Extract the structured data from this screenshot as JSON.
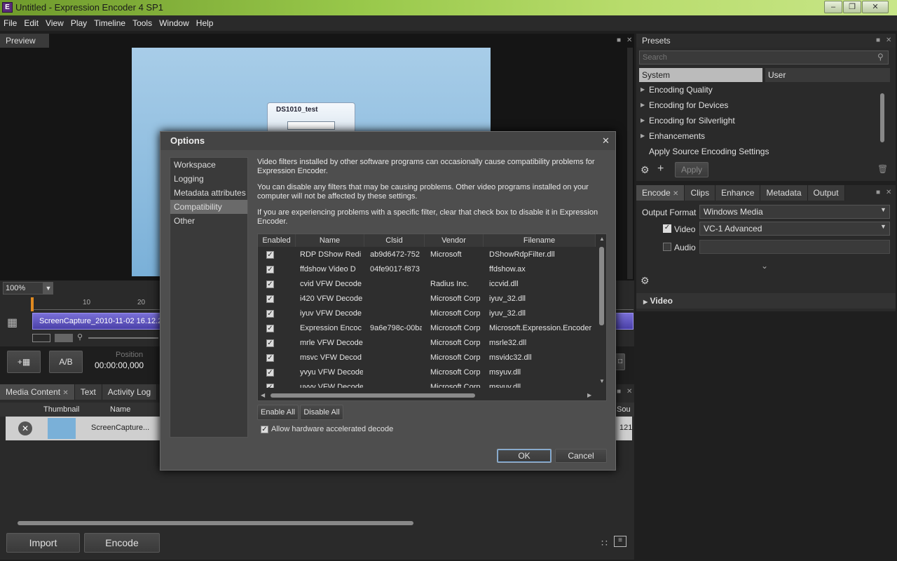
{
  "window": {
    "title": "Untitled - Expression Encoder 4 SP1",
    "icon": "app-icon"
  },
  "menu": [
    "File",
    "Edit",
    "View",
    "Play",
    "Timeline",
    "Tools",
    "Window",
    "Help"
  ],
  "preview": {
    "header": "Preview",
    "zoom": "100%",
    "node_title": "DS1010_test"
  },
  "timeline": {
    "ticks": [
      "10",
      "20"
    ],
    "clip_label": "ScreenCapture_2010-11-02 16.12.2"
  },
  "transport": {
    "ab_label": "A/B",
    "position_label": "Position",
    "position_value": "00:00:00,000"
  },
  "media": {
    "tabs": [
      "Media Content",
      "Text",
      "Activity Log"
    ],
    "col_thumbnail": "Thumbnail",
    "col_name": "Name",
    "col_source": "Sou",
    "item_name": "ScreenCapture...",
    "item_source": "121",
    "import_label": "Import",
    "encode_label": "Encode"
  },
  "presets": {
    "header": "Presets",
    "search_placeholder": "Search",
    "tabs": [
      "System",
      "User"
    ],
    "items": [
      {
        "label": "Encoding Quality",
        "expandable": true
      },
      {
        "label": "Encoding for Devices",
        "expandable": true
      },
      {
        "label": "Encoding for Silverlight",
        "expandable": true
      },
      {
        "label": "Enhancements",
        "expandable": true
      },
      {
        "label": "Apply Source Encoding Settings",
        "expandable": false
      }
    ],
    "apply_label": "Apply"
  },
  "encode": {
    "tabs": [
      "Encode",
      "Clips",
      "Enhance",
      "Metadata",
      "Output"
    ],
    "output_format_label": "Output Format",
    "output_format_value": "Windows Media",
    "video_label": "Video",
    "video_value": "VC-1 Advanced",
    "video_checked": true,
    "audio_label": "Audio",
    "audio_checked": false,
    "video_section": "Video"
  },
  "dialog": {
    "title": "Options",
    "nav": [
      "Workspace",
      "Logging",
      "Metadata attributes",
      "Compatibility",
      "Other"
    ],
    "selected_nav": "Compatibility",
    "para1": "Video filters installed by other software programs can occasionally cause compatibility problems for Expression Encoder.",
    "para2": "You can disable any filters that may be causing problems. Other video programs installed on your computer will not be affected by these settings.",
    "para3": "If you are experiencing problems with a specific filter, clear that check box to disable it in Expression Encoder.",
    "columns": [
      "Enabled",
      "Name",
      "Clsid",
      "Vendor",
      "Filename"
    ],
    "rows": [
      {
        "enabled": true,
        "name": "RDP DShow Redi",
        "clsid": "ab9d6472-752",
        "vendor": "Microsoft",
        "filename": "DShowRdpFilter.dll"
      },
      {
        "enabled": true,
        "name": "ffdshow Video D",
        "clsid": "04fe9017-f873",
        "vendor": "",
        "filename": "ffdshow.ax"
      },
      {
        "enabled": true,
        "name": "cvid VFW Decode",
        "clsid": "",
        "vendor": "Radius Inc.",
        "filename": "iccvid.dll"
      },
      {
        "enabled": true,
        "name": "i420 VFW Decode",
        "clsid": "",
        "vendor": "Microsoft Corp",
        "filename": "iyuv_32.dll"
      },
      {
        "enabled": true,
        "name": "iyuv VFW Decode",
        "clsid": "",
        "vendor": "Microsoft Corp",
        "filename": "iyuv_32.dll"
      },
      {
        "enabled": true,
        "name": "Expression Encoc",
        "clsid": "9a6e798c-00ba",
        "vendor": "Microsoft Corp",
        "filename": "Microsoft.Expression.Encoder"
      },
      {
        "enabled": true,
        "name": "mrle VFW Decode",
        "clsid": "",
        "vendor": "Microsoft Corp",
        "filename": "msrle32.dll"
      },
      {
        "enabled": true,
        "name": "msvc VFW Decod",
        "clsid": "",
        "vendor": "Microsoft Corp",
        "filename": "msvidc32.dll"
      },
      {
        "enabled": true,
        "name": "yvyu VFW Decode",
        "clsid": "",
        "vendor": "Microsoft Corp",
        "filename": "msyuv.dll"
      },
      {
        "enabled": true,
        "name": "uyvy VFW Decode",
        "clsid": "",
        "vendor": "Microsoft Corp",
        "filename": "msyuv.dll"
      }
    ],
    "enable_all": "Enable All",
    "disable_all": "Disable All",
    "hw_decode_label": "Allow hardware accelerated decode",
    "hw_decode_checked": true,
    "ok": "OK",
    "cancel": "Cancel"
  }
}
